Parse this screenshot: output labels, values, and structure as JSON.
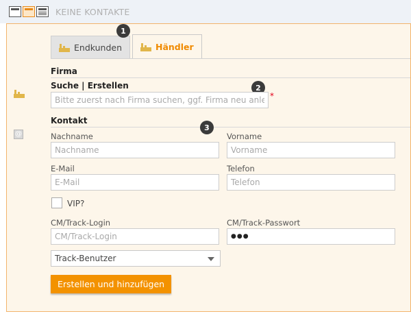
{
  "header": {
    "title": "KEINE KONTAKTE",
    "view_icons": [
      "window-view-icon",
      "orange-view-icon",
      "list-view-icon"
    ]
  },
  "tabs": [
    {
      "label": "Endkunden",
      "icon": "dealer-icon",
      "active": false
    },
    {
      "label": "Händler",
      "icon": "dealer-icon",
      "active": true
    }
  ],
  "badges": {
    "b1": "1",
    "b2": "2",
    "b3": "3"
  },
  "firma": {
    "heading": "Firma",
    "search_label": "Suche | Erstellen",
    "search_placeholder": "Bitte zuerst nach Firma suchen, ggf. Firma neu anlegen",
    "required_mark": "*"
  },
  "kontakt": {
    "heading": "Kontakt",
    "side_icon": "@",
    "nachname_label": "Nachname",
    "nachname_placeholder": "Nachname",
    "vorname_label": "Vorname",
    "vorname_placeholder": "Vorname",
    "email_label": "E-Mail",
    "email_placeholder": "E-Mail",
    "telefon_label": "Telefon",
    "telefon_placeholder": "Telefon",
    "vip_label": "VIP?",
    "login_label": "CM/Track-Login",
    "login_placeholder": "CM/Track-Login",
    "password_label": "CM/Track-Passwort",
    "password_value": "●●●",
    "role_select": "Track-Benutzer",
    "submit_label": "Erstellen und hinzufügen"
  },
  "colors": {
    "accent": "#f39200",
    "panel_bg": "#fdf6ea",
    "panel_border": "#f2b36b",
    "topbar_bg": "#eef2f7",
    "required": "#e2001a"
  }
}
